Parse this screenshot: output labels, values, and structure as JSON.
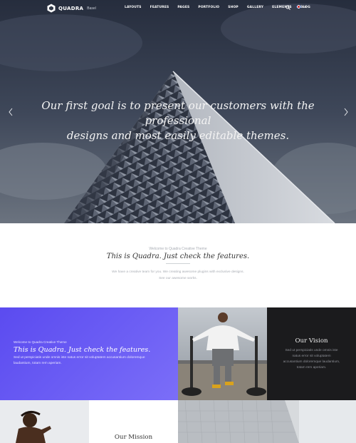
{
  "nav": {
    "logo_text": "QUADRA",
    "logo_sub": "Basel",
    "menu": [
      "LAYOUTS",
      "FEATURES",
      "PAGES",
      "PORTFOLIO",
      "SHOP",
      "GALLERY",
      "ELEMENTS",
      "BLOG"
    ],
    "language": "En"
  },
  "hero": {
    "headline_line1": "Our first goal is to present our customers with the professional",
    "headline_line2": "designs and most easily editable themes."
  },
  "intro": {
    "kicker": "Welcome to Quadra Creative Theme",
    "title": "This is Quadra. Just check the features.",
    "body_line1": "We have a creative team for you. We creating awesome plugins with exclusive designs.",
    "body_line2": "See our awesome works."
  },
  "feature": {
    "kicker": "Welcome to Quadra Creative Theme",
    "title": "This is Quadra. Just check the features.",
    "body_line1": "Sed ut perspiciatis unde omnis iste natus error sit voluptatem accusantium doloremque",
    "body_line2": "laudantium, totam rem aperiam."
  },
  "vision": {
    "title": "Our Vision",
    "body_line1": "Sed ut perspiciatis unde omnis iste",
    "body_line2": "natus error sit voluptatem",
    "body_line3": "accusantium doloremque laudantium,",
    "body_line4": "totam rem aperiam."
  },
  "mission": {
    "title": "Our Mission"
  },
  "colors": {
    "accent_purple": "#6a5cf4",
    "dark_panel": "#1b1b1d"
  }
}
